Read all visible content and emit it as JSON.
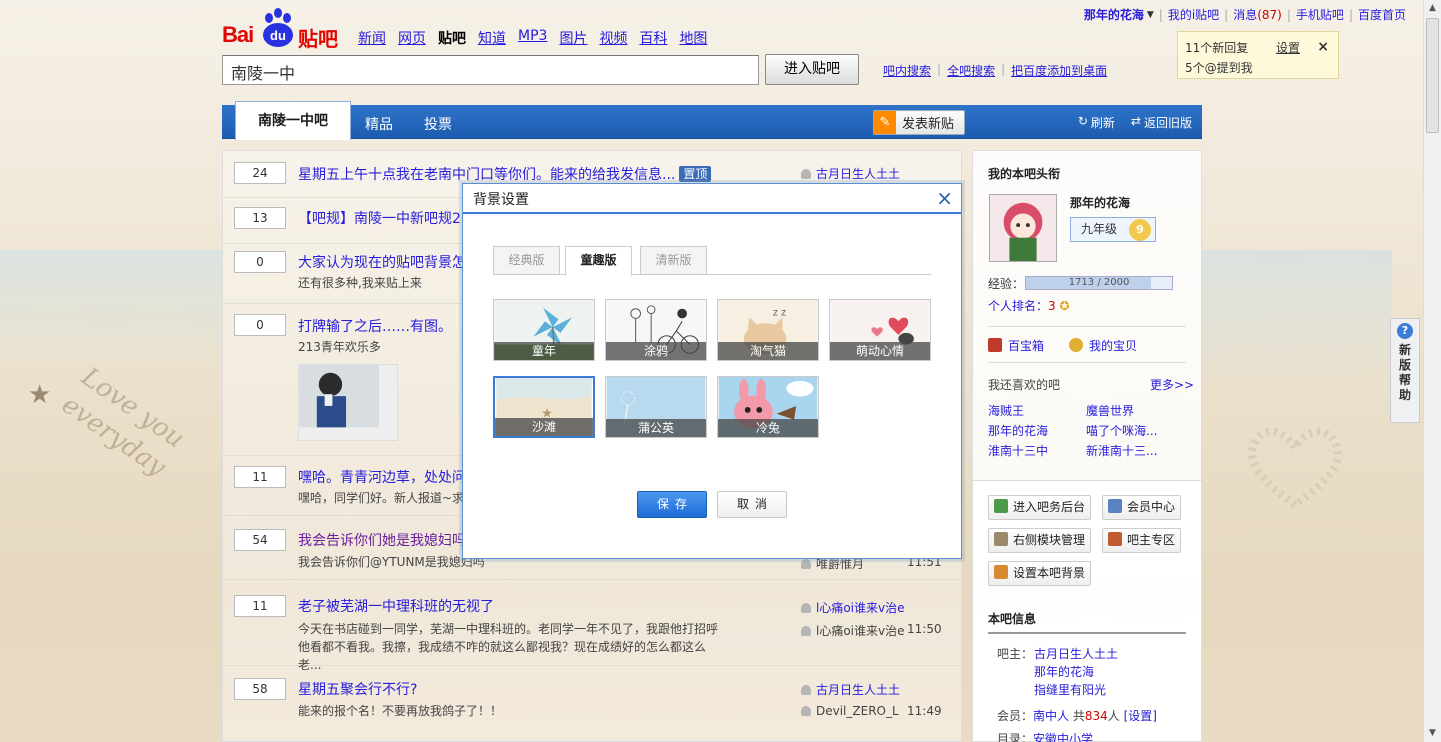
{
  "top": {
    "username": "那年的花海",
    "my_ibar": "我的i贴吧",
    "messages_label": "消息",
    "messages_count": "(87)",
    "mobile": "手机贴吧",
    "home": "百度首页"
  },
  "logo": {
    "bai": "Bai",
    "du": "du",
    "tieba": "贴吧"
  },
  "nav": [
    "新闻",
    "网页",
    "贴吧",
    "知道",
    "MP3",
    "图片",
    "视频",
    "百科",
    "地图"
  ],
  "nav_current": "贴吧",
  "search": {
    "value": "南陵一中",
    "button": "进入贴吧"
  },
  "sublinks": [
    "吧内搜索",
    "全吧搜索",
    "把百度添加到桌面"
  ],
  "notice": {
    "line1": "11个新回复",
    "line2": "5个@提到我",
    "settings": "设置",
    "close": "×"
  },
  "tabs": {
    "active": "南陵一中吧",
    "t2": "精品",
    "t3": "投票",
    "post": "发表新贴",
    "refresh": "刷新",
    "old": "返回旧版"
  },
  "threads": [
    {
      "count": "24",
      "title": "星期五上午十点我在老南中门口等你们。能来的给我发信息...",
      "tag": "置顶",
      "author": "古月日生人土土"
    },
    {
      "count": "13",
      "title": "【吧规】南陵一中新吧规20"
    },
    {
      "count": "0",
      "title": "大家认为现在的贴吧背景怎",
      "abstract": "还有很多种,我来贴上来"
    },
    {
      "count": "0",
      "title": "打牌输了之后……有图。",
      "abstract": "213青年欢乐多"
    },
    {
      "count": "11",
      "title": "嘿哈。青青河边草，处处问",
      "abstract": "嘿哈，同学们好。新人报道~求"
    },
    {
      "count": "54",
      "title": "我会告诉你们她是我媳妇吗",
      "abstract": "我会告诉你们@YTUNM是我媳妇吗",
      "reply": "唯爵惟月",
      "time": "11:51"
    },
    {
      "count": "11",
      "title": "老子被芜湖一中理科班的无视了",
      "abstract": "今天在书店碰到一同学，芜湖一中理科班的。老同学一年不见了，我跟他打招呼他看都不看我。我擦，我成绩不咋的就这么鄙视我？现在成绩好的怎么都这么老...",
      "author": "l心痛oi谁来v治e",
      "reply": "l心痛oi谁来v治e",
      "time": "11:50"
    },
    {
      "count": "58",
      "title": "星期五聚会行不行?",
      "abstract": "能来的报个名！不要再放我鸽子了！！",
      "author": "古月日生人土土",
      "reply": "Devil_ZERO_L",
      "time": "11:49"
    }
  ],
  "side": {
    "title": "我的本吧头衔",
    "name": "那年的花海",
    "grade": "九年级",
    "level": "9",
    "exp_label": "经验：",
    "exp_value": "1713 / 2000",
    "exp_fraction": 0.8565,
    "rank_label": "个人排名：",
    "rank_value": "3",
    "treasure": "百宝箱",
    "mytreasure": "我的宝贝",
    "fav_title": "我还喜欢的吧",
    "more": "更多>>",
    "favs": [
      "海贼王",
      "魔兽世界",
      "那年的花海",
      "喵了个咪海...",
      "淮南十三中",
      "新淮南十三..."
    ],
    "btn1": "进入吧务后台",
    "btn2": "会员中心",
    "btn3": "右侧模块管理",
    "btn4": "吧主专区",
    "btn5": "设置本吧背景",
    "info_title": "本吧信息",
    "owner_label": "吧主：",
    "owners": [
      "古月日生人土土",
      "那年的花海",
      "指缝里有阳光"
    ],
    "member_label": "会员：",
    "member_name": "南中人",
    "member_total_pre": "共",
    "member_count": "834",
    "member_unit": "人",
    "member_set": "[设置]",
    "dir_label": "目录：",
    "dir_value": "安徽中小学"
  },
  "help": {
    "q": "?",
    "text": "新版帮助"
  },
  "dialog": {
    "title": "背景设置",
    "close": "×",
    "tabs": [
      "经典版",
      "童趣版",
      "清新版"
    ],
    "skins": [
      "童年",
      "涂鸦",
      "淘气猫",
      "萌动心情",
      "沙滩",
      "蒲公英",
      "冷兔"
    ],
    "save": "保存",
    "cancel": "取消"
  },
  "colors": {
    "brand_blue": "#1c5cb0",
    "link": "#261cdc",
    "accent_red": "#e10601"
  }
}
